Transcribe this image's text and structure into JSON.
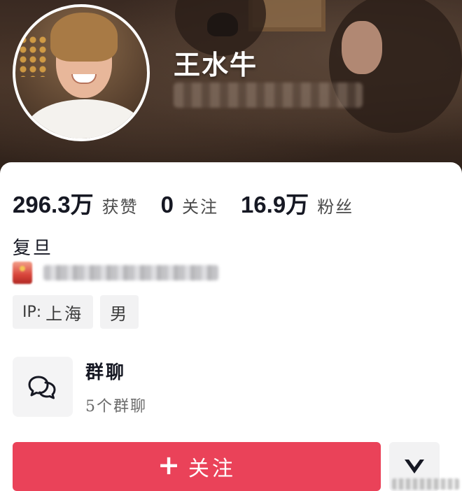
{
  "profile": {
    "username": "王水牛"
  },
  "stats": [
    {
      "value": "296.3万",
      "label": "获赞"
    },
    {
      "value": "0",
      "label": "关注"
    },
    {
      "value": "16.9万",
      "label": "粉丝"
    }
  ],
  "bio": {
    "school": "复旦"
  },
  "tags": {
    "ip_prefix": "IP:",
    "ip_location": "上海",
    "gender": "男"
  },
  "group_chat": {
    "title": "群聊",
    "subtitle": "5个群聊",
    "icon": "chat-bubbles-icon"
  },
  "actions": {
    "follow_plus": "+",
    "follow_label": "关注",
    "more_icon": "chevron-down-icon"
  },
  "colors": {
    "accent": "#ea4259",
    "tag_bg": "#f2f2f3",
    "text_primary": "#161823"
  }
}
